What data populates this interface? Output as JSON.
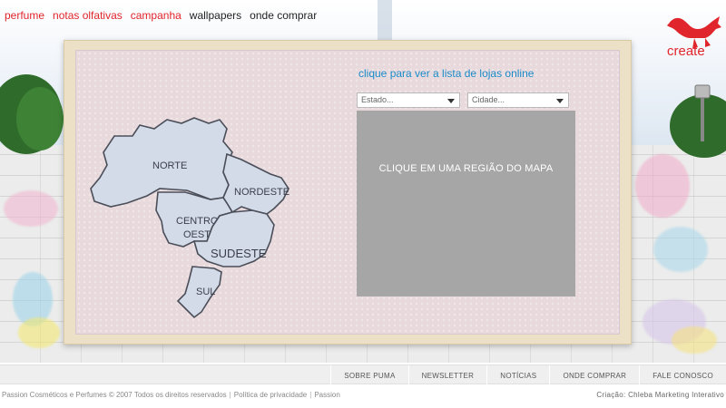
{
  "topnav": {
    "items": [
      {
        "label": "perfume",
        "color": "#e0252c"
      },
      {
        "label": "notas olfativas",
        "color": "#e0252c"
      },
      {
        "label": "campanha",
        "color": "#e0252c"
      },
      {
        "label": "wallpapers",
        "color": "#222222"
      },
      {
        "label": "onde comprar",
        "color": "#222222"
      }
    ]
  },
  "brand": {
    "logo_text": "create",
    "logo_icon": "puma-cat-icon",
    "accent": "#e0252c"
  },
  "store_finder": {
    "link_text": "clique para ver a lista de lojas online",
    "estado_select": "Estado...",
    "cidade_select": "Cidade...",
    "results_message": "CLIQUE EM UMA REGIÃO DO MAPA"
  },
  "map": {
    "regions": [
      {
        "id": "norte",
        "label": "NORTE"
      },
      {
        "id": "nordeste",
        "label": "NORDESTE"
      },
      {
        "id": "centro-oeste",
        "label_line1": "CENTRO",
        "label_line2": "OESTE"
      },
      {
        "id": "sudeste",
        "label": "SUDESTE"
      },
      {
        "id": "sul",
        "label": "SUL"
      }
    ],
    "region_fill": "#d4dbe8"
  },
  "footer": {
    "links": [
      "SOBRE PUMA",
      "NEWSLETTER",
      "NOTÍCIAS",
      "ONDE COMPRAR",
      "FALE CONOSCO"
    ],
    "copyright": "Passion Cosméticos e Perfumes © 2007 Todos os direitos reservados",
    "privacy": "Política de privacidade",
    "passion": "Passion",
    "credit": "Criação: Chleba Marketing Interativo"
  }
}
